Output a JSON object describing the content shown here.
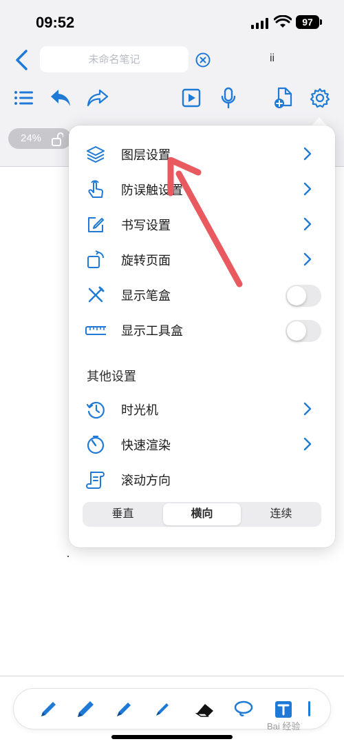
{
  "status_bar": {
    "time": "09:52",
    "battery": "97"
  },
  "nav": {
    "title_placeholder": "未命名笔记",
    "extra_label": "ii"
  },
  "canvas": {
    "zoom": "24%"
  },
  "menu": {
    "items": [
      {
        "label": "图层设置",
        "icon": "layers-icon",
        "control": "chevron"
      },
      {
        "label": "防误触设置",
        "icon": "touch-icon",
        "control": "chevron"
      },
      {
        "label": "书写设置",
        "icon": "edit-icon",
        "control": "chevron"
      },
      {
        "label": "旋转页面",
        "icon": "rotate-icon",
        "control": "chevron"
      },
      {
        "label": "显示笔盒",
        "icon": "pens-icon",
        "control": "toggle",
        "on": false
      },
      {
        "label": "显示工具盒",
        "icon": "ruler-icon",
        "control": "toggle",
        "on": false
      }
    ],
    "section_title": "其他设置",
    "other_items": [
      {
        "label": "时光机",
        "icon": "history-icon",
        "control": "chevron"
      },
      {
        "label": "快速渲染",
        "icon": "timer-icon",
        "control": "chevron"
      },
      {
        "label": "滚动方向",
        "icon": "scroll-icon",
        "control": "none"
      }
    ],
    "scroll_options": [
      "垂直",
      "横向",
      "连续"
    ],
    "scroll_selected": "横向"
  },
  "watermark": "Bai 经验",
  "colors": {
    "accent": "#1e7ad6",
    "arrow": "#e85a5f"
  }
}
